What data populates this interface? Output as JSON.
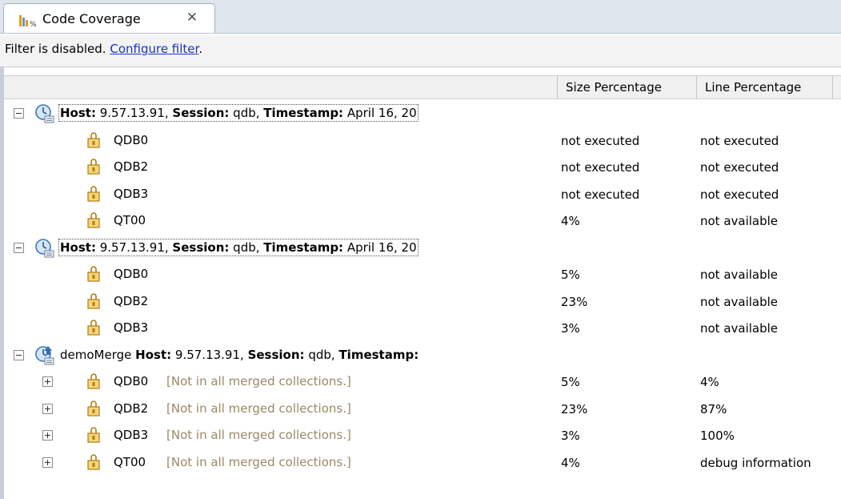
{
  "tab": {
    "title": "Code Coverage",
    "close_glyph": "✕"
  },
  "filter": {
    "text": "Filter is disabled. ",
    "link": "Configure filter",
    "end": "."
  },
  "columns": {
    "size": "Size Percentage",
    "line": "Line Percentage"
  },
  "labels": {
    "host": "Host:",
    "session": "Session:",
    "timestamp": "Timestamp:"
  },
  "sessions": [
    {
      "host": "9.57.13.91,",
      "session": "qdb,",
      "timestamp": "April 16, 20",
      "programs": [
        {
          "name": "QDB0",
          "size": "not executed",
          "line": "not executed"
        },
        {
          "name": "QDB2",
          "size": "not executed",
          "line": "not executed"
        },
        {
          "name": "QDB3",
          "size": "not executed",
          "line": "not executed"
        },
        {
          "name": "QT00",
          "size": "4%",
          "line": "not available"
        }
      ]
    },
    {
      "host": "9.57.13.91,",
      "session": "qdb,",
      "timestamp": "April 16, 20",
      "programs": [
        {
          "name": "QDB0",
          "size": "5%",
          "line": "not available"
        },
        {
          "name": "QDB2",
          "size": "23%",
          "line": "not available"
        },
        {
          "name": "QDB3",
          "size": "3%",
          "line": "not available"
        }
      ]
    },
    {
      "merge_name": "demoMerge",
      "host": "9.57.13.91,",
      "session": "qdb,",
      "timestamp": "",
      "programs": [
        {
          "name": "QDB0",
          "note": "[Not in all merged collections.]",
          "size": "5%",
          "line": "4%"
        },
        {
          "name": "QDB2",
          "note": "[Not in all merged collections.]",
          "size": "23%",
          "line": "87%"
        },
        {
          "name": "QDB3",
          "note": "[Not in all merged collections.]",
          "size": "3%",
          "line": "100%"
        },
        {
          "name": "QT00",
          "note": "[Not in all merged collections.]",
          "size": "4%",
          "line": "debug information"
        }
      ]
    }
  ],
  "icons": {
    "tab": "coverage-chart-icon",
    "session": "clock-session-icon",
    "merged": "merged-session-icon",
    "program": "program-object-icon"
  },
  "colors": {
    "note": "#9a8866",
    "link": "#1a34b8",
    "header_bg": "#f0f0f0"
  }
}
